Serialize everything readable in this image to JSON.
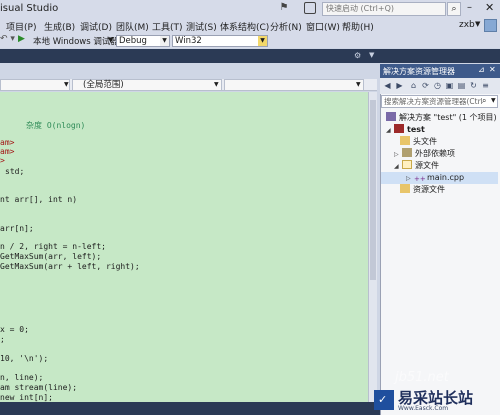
{
  "title_bar": {
    "app_title": "isual Studio",
    "quick_launch_placeholder": "快速启动 (Ctrl+Q)"
  },
  "menu": [
    "项目(P)",
    "生成(B)",
    "调试(D)",
    "团队(M)",
    "工具(T)",
    "测试(S)",
    "体系结构(C)",
    "分析(N)",
    "窗口(W)",
    "帮助(H)"
  ],
  "user": {
    "name": "zxb"
  },
  "toolbar": {
    "local_debugger": "本地 Windows 调试器",
    "configuration": "Debug",
    "platform": "Win32"
  },
  "editor": {
    "scope_combo": "(全局范围)",
    "code_lines": [
      {
        "text": "杂度 O(nlogn)",
        "kind": "comment"
      },
      {
        "text": "am>",
        "kind": "preproc"
      },
      {
        "text": "am>",
        "kind": "preproc"
      },
      {
        "text": ">",
        "kind": "preproc"
      },
      {
        "text": "std;",
        "kind": "normal"
      },
      {
        "text": "nt arr[], int n)",
        "kind": "normal"
      },
      {
        "text": "arr[n];",
        "kind": "normal"
      },
      {
        "text": "n / 2, right = n-left;",
        "kind": "normal"
      },
      {
        "text": "GetMaxSum(arr, left);",
        "kind": "normal"
      },
      {
        "text": "GetMaxSum(arr + left, right);",
        "kind": "normal"
      },
      {
        "text": "x = 0;",
        "kind": "normal"
      },
      {
        "text": ";",
        "kind": "normal"
      },
      {
        "text": "10, '\\n');",
        "kind": "normal"
      },
      {
        "text": "n, line);",
        "kind": "normal"
      },
      {
        "text": "am stream(line);",
        "kind": "normal"
      },
      {
        "text": "new int[n];",
        "kind": "normal"
      }
    ]
  },
  "solution_explorer": {
    "title": "解决方案资源管理器",
    "search_placeholder": "搜索解决方案资源管理器(Ctrl",
    "tree": {
      "solution": "解决方案 \"test\" (1 个项目)",
      "project": "test",
      "headers": "头文件",
      "external": "外部依赖项",
      "sources": "源文件",
      "main_file": "main.cpp",
      "resources": "资源文件"
    }
  },
  "watermark": {
    "site": "jb51.net",
    "brand": "易采站长站",
    "url": "Www.Easck.Com"
  }
}
